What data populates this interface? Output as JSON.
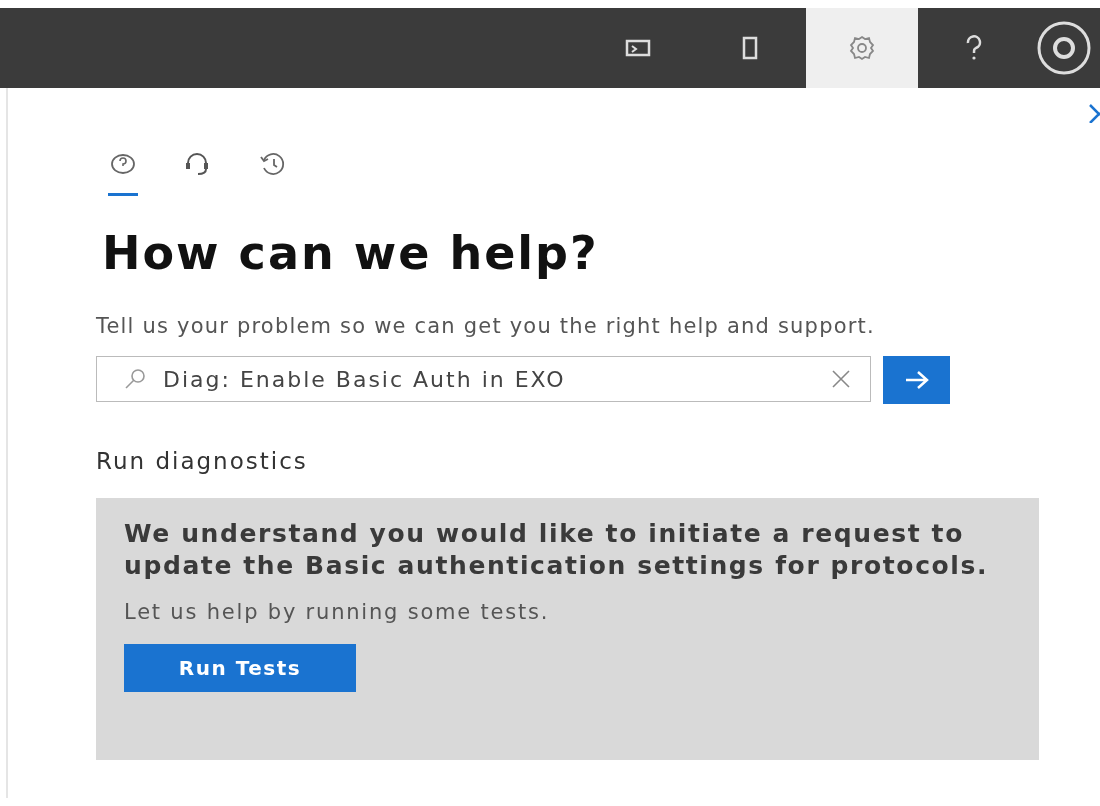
{
  "toolbar": [
    {
      "kind": "screen",
      "selected": false
    },
    {
      "kind": "phone",
      "selected": false
    },
    {
      "kind": "gear",
      "selected": true
    },
    {
      "kind": "help",
      "selected": false
    },
    {
      "kind": "avatar",
      "selected": false
    }
  ],
  "panel_tabs": [
    {
      "kind": "question",
      "selected": true
    },
    {
      "kind": "headset",
      "selected": false
    },
    {
      "kind": "history",
      "selected": false
    }
  ],
  "heading": "How can we help?",
  "subtitle": "Tell us your problem so we can get you the right help and support.",
  "search": {
    "value": "Diag: Enable Basic Auth in EXO"
  },
  "section_title": "Run diagnostics",
  "card": {
    "message": "We understand you would like to initiate a request to update the Basic authentication settings for protocols.",
    "hint": "Let us help by running some tests.",
    "button": "Run Tests"
  }
}
